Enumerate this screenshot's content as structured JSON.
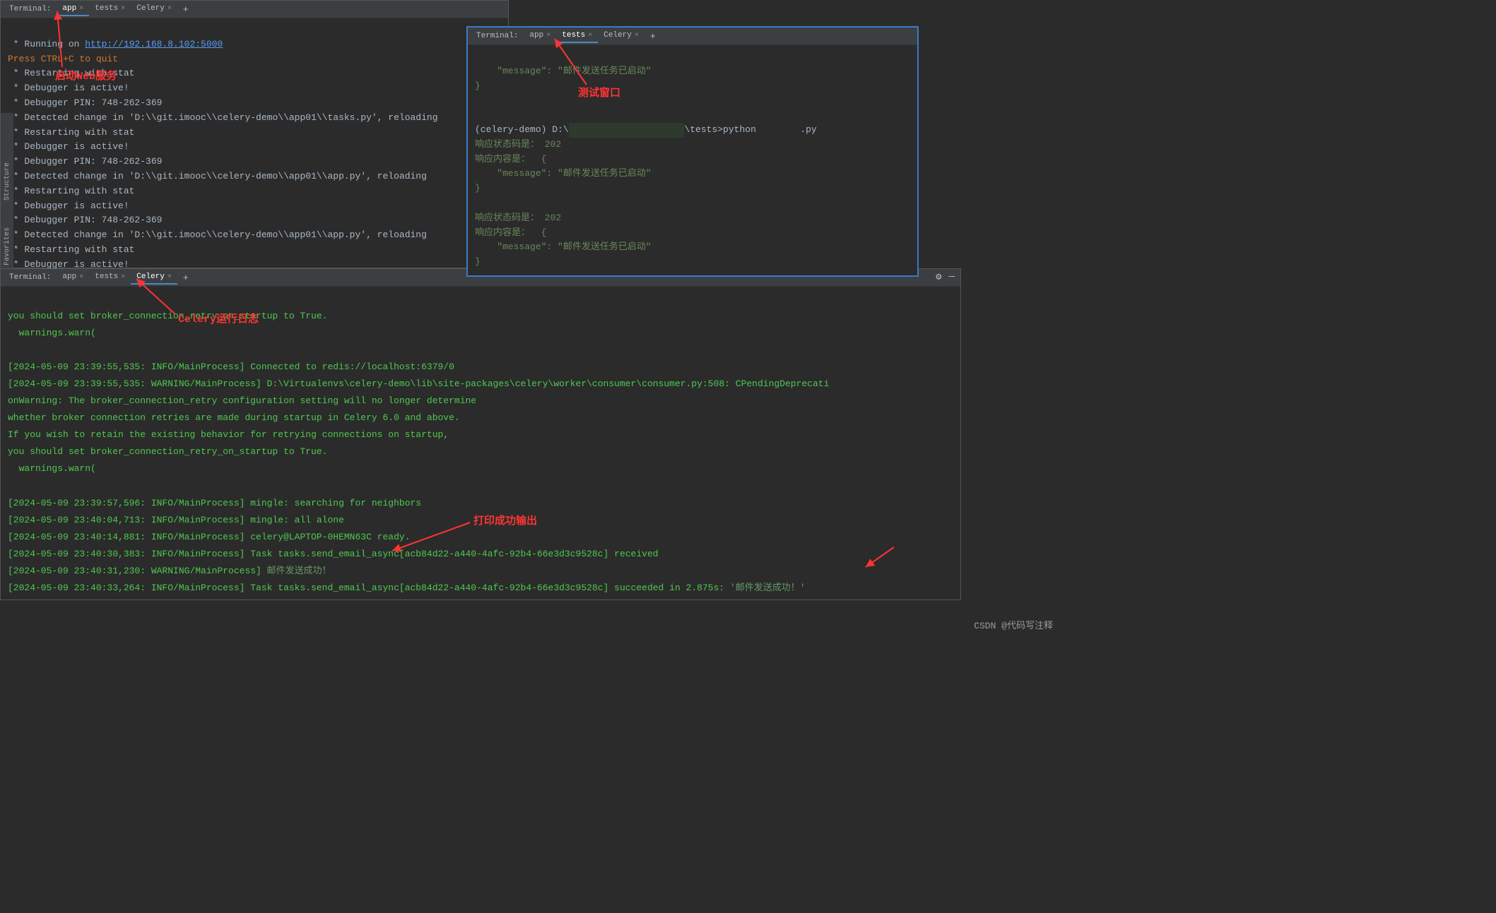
{
  "panels": {
    "topleft": {
      "terminal_label": "Terminal:",
      "tabs": [
        {
          "label": "app",
          "active": true
        },
        {
          "label": "tests",
          "active": false
        },
        {
          "label": "Celery",
          "active": false
        }
      ],
      "lines": {
        "running": " * Running on ",
        "url": "http://192.168.8.102:5000",
        "quit": "Press CTRL+C to quit",
        "restart": " * Restarting with stat",
        "debug_active": " * Debugger is active!",
        "debug_pin": " * Debugger PIN: 748-262-369",
        "detect_tasks": " * Detected change in 'D:\\\\git.imooc\\\\celery-demo\\\\app01\\\\tasks.py', reloading",
        "detect_app": " * Detected change in 'D:\\\\git.imooc\\\\celery-demo\\\\app01\\\\app.py', reloading"
      }
    },
    "topright": {
      "terminal_label": "Terminal:",
      "tabs": [
        {
          "label": "app",
          "active": false
        },
        {
          "label": "tests",
          "active": true
        },
        {
          "label": "Celery",
          "active": false
        }
      ],
      "lines": {
        "msg_key": "    \"message\"",
        "colon": ": ",
        "msg_val": "\"邮件发送任务已启动\"",
        "brace_close": "}",
        "blank": "",
        "prompt_pre": "(celery-demo) D:\\",
        "prompt_post": "\\tests>python        .py",
        "status_code": "响应状态码是： 202",
        "content_is": "响应内容是：  {",
        "msg_line": "    \"message\": \"邮件发送任务已启动\""
      }
    },
    "bottom": {
      "terminal_label": "Terminal:",
      "tabs": [
        {
          "label": "app",
          "active": false
        },
        {
          "label": "tests",
          "active": false
        },
        {
          "label": "Celery",
          "active": true
        }
      ],
      "lines": {
        "l1": "you should set broker_connection_retry_on_startup to True.",
        "l2": "  warnings.warn(",
        "l3": "",
        "l4": "[2024-05-09 23:39:55,535: INFO/MainProcess] Connected to redis://localhost:6379/0",
        "l5": "[2024-05-09 23:39:55,535: WARNING/MainProcess] D:\\Virtualenvs\\celery-demo\\lib\\site-packages\\celery\\worker\\consumer\\consumer.py:508: CPendingDeprecati",
        "l6": "onWarning: The broker_connection_retry configuration setting will no longer determine",
        "l7": "whether broker connection retries are made during startup in Celery 6.0 and above.",
        "l8": "If you wish to retain the existing behavior for retrying connections on startup,",
        "l9": "you should set broker_connection_retry_on_startup to True.",
        "l10": "  warnings.warn(",
        "l11": "",
        "l12": "[2024-05-09 23:39:57,596: INFO/MainProcess] mingle: searching for neighbors",
        "l13": "[2024-05-09 23:40:04,713: INFO/MainProcess] mingle: all alone",
        "l14": "[2024-05-09 23:40:14,881: INFO/MainProcess] celery@LAPTOP-0HEMN63C ready.",
        "l15": "[2024-05-09 23:40:30,383: INFO/MainProcess] Task tasks.send_email_async[acb84d22-a440-4afc-92b4-66e3d3c9528c] received",
        "l16a": "[2024-05-09 23:40:31,230: WARNING/MainProcess] ",
        "l16b": "邮件发送成功！",
        "l17a": "[2024-05-09 23:40:33,264: INFO/MainProcess] Task tasks.send_email_async[acb84d22-a440-4afc-92b4-66e3d3c9528c] succeeded in 2.875s: ",
        "l17b": "'邮件发送成功！'"
      },
      "toolbar": {
        "gear": "⚙",
        "minimize": "—"
      }
    }
  },
  "sidebar": {
    "items": [
      "Structure",
      "Favorites"
    ]
  },
  "annotations": {
    "web_service": "启动Web服务",
    "test_window": "测试窗口",
    "celery_log": "Celery运行日志",
    "print_success": "打印成功输出"
  },
  "watermark": "CSDN @代码写注释"
}
